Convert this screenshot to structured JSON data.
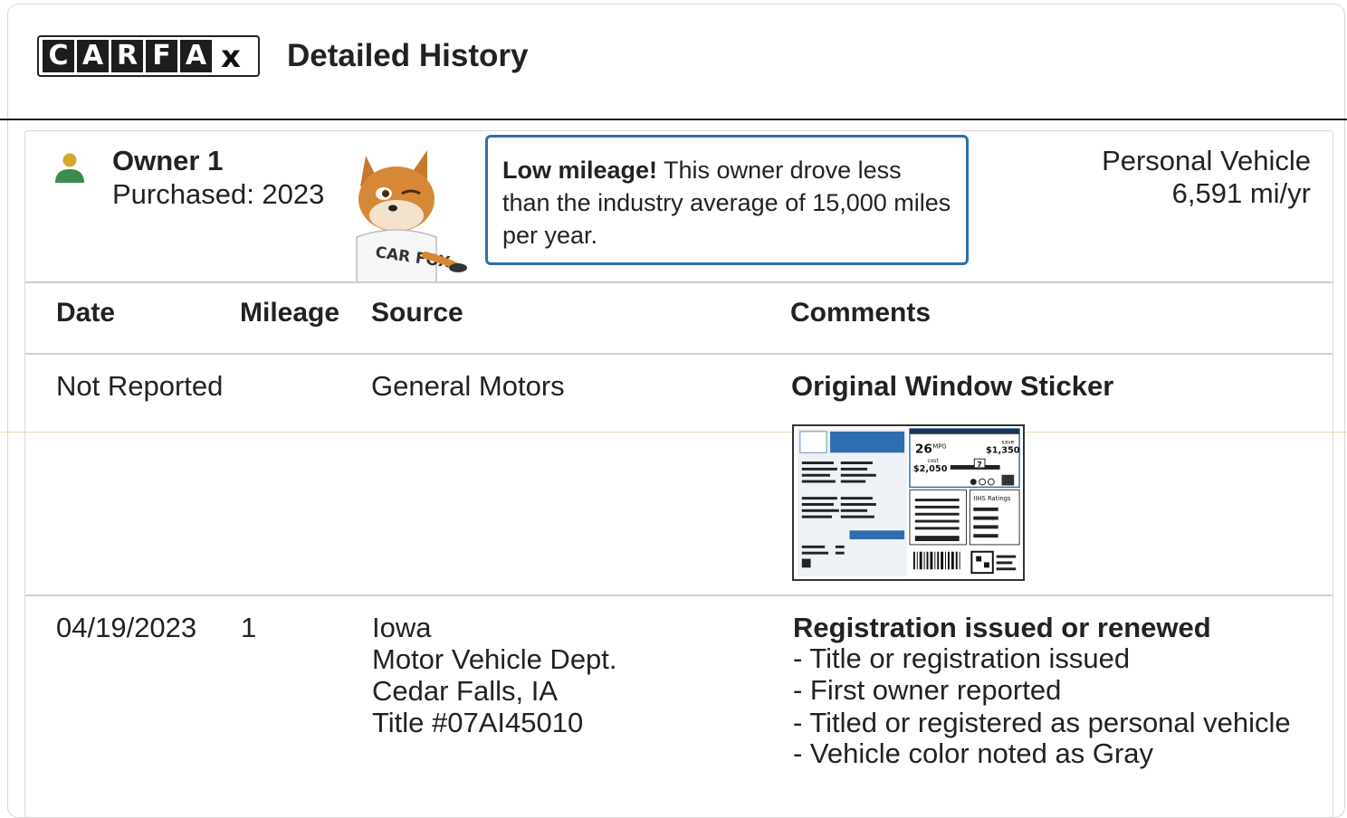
{
  "header": {
    "logo_letters": [
      "C",
      "A",
      "R",
      "F",
      "A",
      "x"
    ],
    "title": "Detailed History"
  },
  "owner": {
    "name": "Owner 1",
    "purchased": "Purchased: 2023",
    "icon": "person-icon",
    "mascot_shirt_text": "CAR FOX"
  },
  "mileage_note": {
    "lead": "Low mileage!",
    "text": " This owner drove less than the industry average of 15,000 miles per year."
  },
  "vehicle": {
    "type": "Personal Vehicle",
    "miles": "6,591 mi/yr"
  },
  "table": {
    "headers": {
      "date": "Date",
      "mileage": "Mileage",
      "source": "Source",
      "comments": "Comments"
    },
    "rows": [
      {
        "date": "Not Reported",
        "mileage": "",
        "source": [
          "General Motors"
        ],
        "comment_title": "Original Window Sticker",
        "comment_items": []
      },
      {
        "date": "04/19/2023",
        "mileage": "1",
        "source": [
          "Iowa",
          "Motor Vehicle Dept.",
          "Cedar Falls, IA",
          "Title #07AI45010"
        ],
        "comment_title": "Registration issued or renewed",
        "comment_items": [
          "- Title or registration issued",
          "- First owner reported",
          "- Titled or registered as personal vehicle",
          "- Vehicle color noted as Gray"
        ]
      }
    ]
  },
  "sticker": {
    "mpg": "26",
    "mpg_unit": "MPG",
    "save_label": "save",
    "save": "$1,350",
    "cost_label": "cost",
    "cost": "$2,050",
    "rating": "7",
    "ihs_label": "IIHS Ratings"
  },
  "colors": {
    "accent_blue": "#2e6db0",
    "owner_icon_head": "#d4a82a",
    "owner_icon_body": "#3d8a4e"
  }
}
